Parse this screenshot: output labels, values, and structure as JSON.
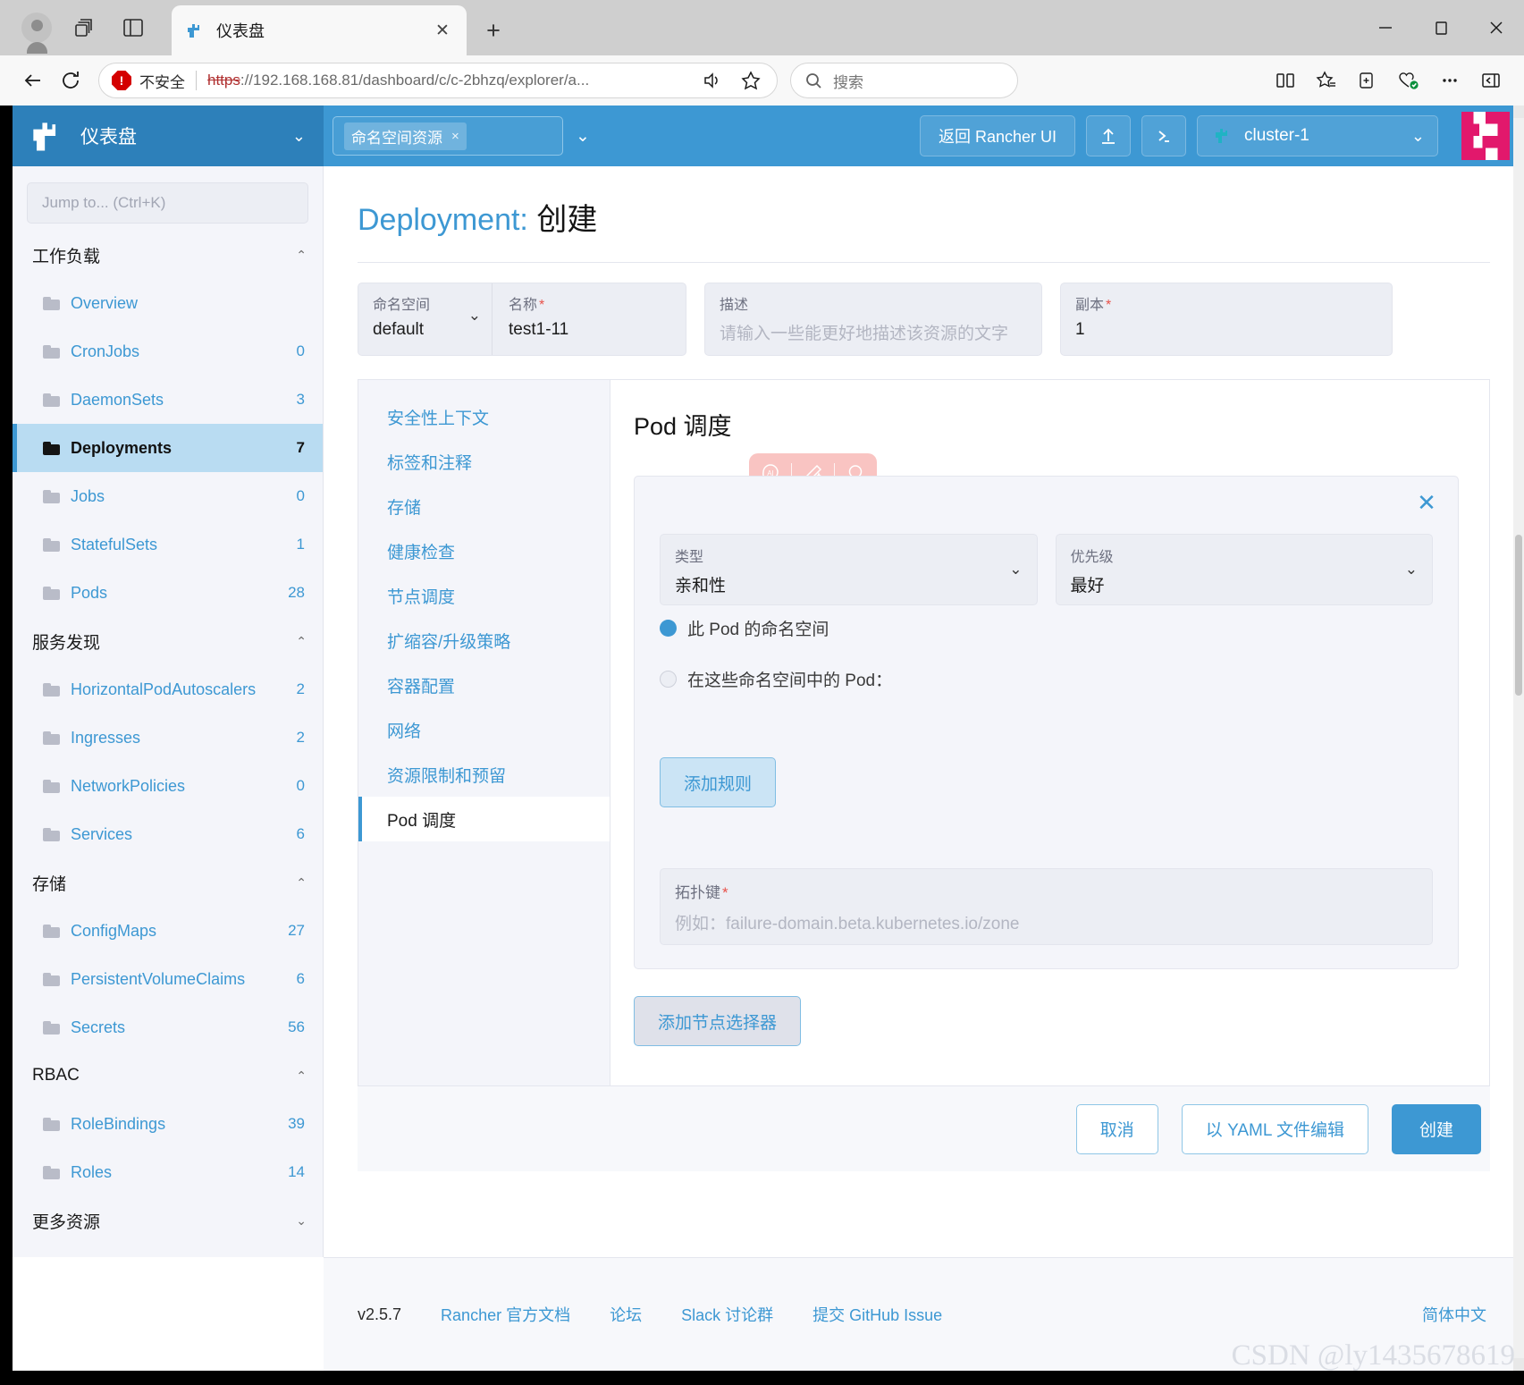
{
  "browser": {
    "tab_title": "仪表盘",
    "tab_close": "✕",
    "newtab": "+",
    "security_label": "不安全",
    "url_scheme": "https",
    "url_rest": "://192.168.168.81/dashboard/c/c-2bhzq/explorer/a...",
    "url_host": "192.168.168.81",
    "search_placeholder": "搜索",
    "minimize": "—",
    "maximize": "▢",
    "close": "✕"
  },
  "header": {
    "product_title": "仪表盘",
    "ns_filter_chip": "命名空间资源",
    "ns_filter_chip_x": "×",
    "back_to_rancher": "返回 Rancher UI",
    "import_icon_label": "⇧",
    "shell_icon_label": "≻",
    "cluster_name": "cluster-1"
  },
  "sidebar": {
    "jump_placeholder": "Jump to... (Ctrl+K)",
    "groups": [
      {
        "label": "工作负载",
        "chevron": "⌃",
        "items": [
          {
            "label": "Overview",
            "count": ""
          },
          {
            "label": "CronJobs",
            "count": "0"
          },
          {
            "label": "DaemonSets",
            "count": "3"
          },
          {
            "label": "Deployments",
            "count": "7",
            "active": true
          },
          {
            "label": "Jobs",
            "count": "0"
          },
          {
            "label": "StatefulSets",
            "count": "1"
          },
          {
            "label": "Pods",
            "count": "28"
          }
        ]
      },
      {
        "label": "服务发现",
        "chevron": "⌃",
        "items": [
          {
            "label": "HorizontalPodAutoscalers",
            "count": "2"
          },
          {
            "label": "Ingresses",
            "count": "2"
          },
          {
            "label": "NetworkPolicies",
            "count": "0"
          },
          {
            "label": "Services",
            "count": "6"
          }
        ]
      },
      {
        "label": "存储",
        "chevron": "⌃",
        "items": [
          {
            "label": "ConfigMaps",
            "count": "27"
          },
          {
            "label": "PersistentVolumeClaims",
            "count": "6"
          },
          {
            "label": "Secrets",
            "count": "56"
          }
        ]
      },
      {
        "label": "RBAC",
        "chevron": "⌃",
        "items": [
          {
            "label": "RoleBindings",
            "count": "39"
          },
          {
            "label": "Roles",
            "count": "14"
          }
        ]
      },
      {
        "label": "更多资源",
        "chevron": "⌄",
        "items": []
      }
    ]
  },
  "main": {
    "title_prefix": "Deployment:",
    "title_suffix": "创建",
    "fields": {
      "namespace_label": "命名空间",
      "namespace_value": "default",
      "namespace_chevron": "⌄",
      "name_label": "名称",
      "name_required": "*",
      "name_value": "test1-11",
      "desc_label": "描述",
      "desc_placeholder": "请输入一些能更好地描述该资源的文字",
      "replicas_label": "副本",
      "replicas_required": "*",
      "replicas_value": "1"
    },
    "tabs": [
      {
        "label": "安全性上下文"
      },
      {
        "label": "标签和注释"
      },
      {
        "label": "存储"
      },
      {
        "label": "健康检查"
      },
      {
        "label": "节点调度"
      },
      {
        "label": "扩缩容/升级策略"
      },
      {
        "label": "容器配置"
      },
      {
        "label": "网络"
      },
      {
        "label": "资源限制和预留"
      },
      {
        "label": "Pod 调度",
        "active": true
      }
    ],
    "panel": {
      "title": "Pod 调度",
      "close_icon": "✕",
      "type_label": "类型",
      "type_value": "亲和性",
      "type_chevron": "⌄",
      "priority_label": "优先级",
      "priority_value": "最好",
      "priority_chevron": "⌄",
      "radio_this_ns": "此 Pod 的命名空间",
      "radio_these_ns": "在这些命名空间中的 Pod：",
      "add_rule_button": "添加规则",
      "topology_label": "拓扑键",
      "topology_required": "*",
      "topology_placeholder": "例如：failure-domain.beta.kubernetes.io/zone",
      "add_node_selector_button": "添加节点选择器"
    },
    "actions": {
      "cancel": "取消",
      "edit_yaml": "以 YAML 文件编辑",
      "create": "创建"
    }
  },
  "footer": {
    "version": "v2.5.7",
    "links": [
      "Rancher 官方文档",
      "论坛",
      "Slack 讨论群",
      "提交 GitHub Issue"
    ],
    "language": "简体中文",
    "watermark": "CSDN @ly1435678619"
  },
  "colors": {
    "rancher_blue": "#3d98d3",
    "rancher_blue_dark": "#2d80ba",
    "active_nav": "#b9dcf2",
    "required_red": "#e8524a",
    "ai_pink": "#f9c0bd"
  }
}
